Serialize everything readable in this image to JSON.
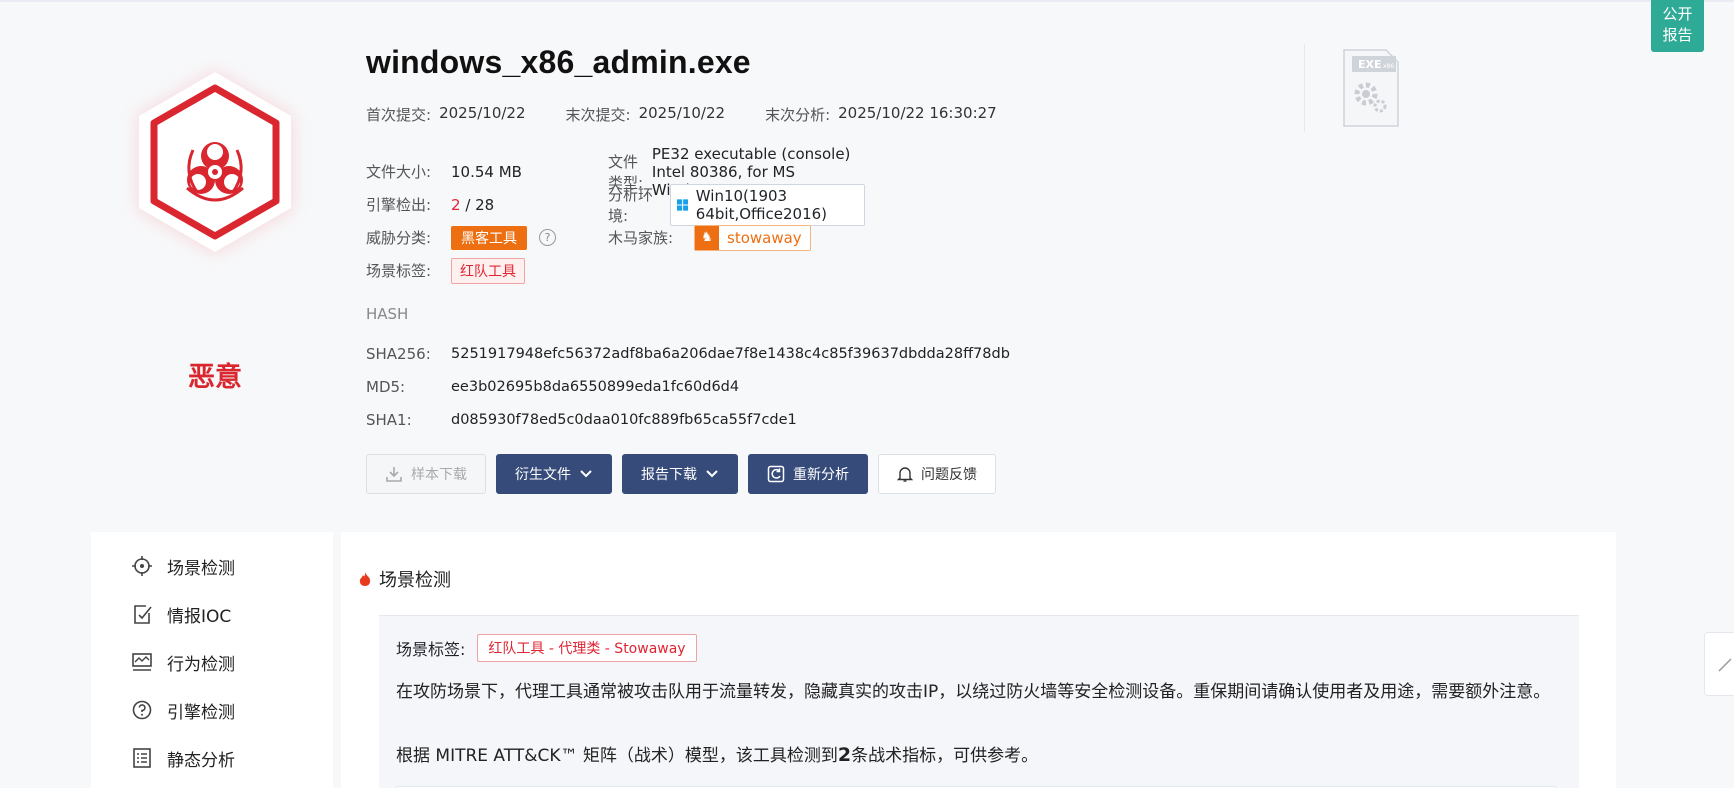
{
  "file": {
    "title": "windows_x86_admin.exe",
    "verdict": "恶意",
    "first_submit_label": "首次提交:",
    "first_submit": "2025/10/22",
    "last_submit_label": "末次提交:",
    "last_submit": "2025/10/22",
    "last_analysis_label": "末次分析:",
    "last_analysis": "2025/10/22 16:30:27",
    "size_label": "文件大小:",
    "size": "10.54 MB",
    "type_label": "文件类型:",
    "type": "PE32 executable (console) Intel 80386, for MS Windows",
    "engine_label": "引擎检出:",
    "engine_hits": "2",
    "engine_total": " / 28",
    "env_label": "分析环境:",
    "env": "Win10(1903 64bit,Office2016)",
    "threat_label": "威胁分类:",
    "threat": "黑客工具",
    "family_label": "木马家族:",
    "family": "stowaway",
    "scene_label": "场景标签:",
    "scene": "红队工具",
    "file_icon_label": "EXE",
    "file_icon_sub": "x86"
  },
  "hash": {
    "title": "HASH",
    "sha256_label": "SHA256:",
    "sha256": "5251917948efc56372adf8ba6a206dae7f8e1438c4c85f39637dbdda28ff78db",
    "md5_label": "MD5:",
    "md5": "ee3b02695b8da6550899eda1fc60d6d4",
    "sha1_label": "SHA1:",
    "sha1": "d085930f78ed5c0daa010fc889fb65ca55f7cde1"
  },
  "buttons": {
    "download_sample": "样本下载",
    "derived_files": "衍生文件",
    "report_download": "报告下载",
    "reanalyze": "重新分析",
    "feedback": "问题反馈"
  },
  "public_report": {
    "line1": "公开",
    "line2": "报告"
  },
  "sidebar": {
    "items": [
      {
        "label": "场景检测",
        "icon": "crosshair-icon"
      },
      {
        "label": "情报IOC",
        "icon": "edit-check-icon"
      },
      {
        "label": "行为检测",
        "icon": "monitor-activity-icon"
      },
      {
        "label": "引擎检测",
        "icon": "question-circle-icon"
      },
      {
        "label": "静态分析",
        "icon": "list-doc-icon"
      }
    ]
  },
  "section": {
    "title": "场景检测",
    "scene_label": "场景标签:",
    "scene_tag": "红队工具 - 代理类 - Stowaway",
    "paragraph": "在攻防场景下，代理工具通常被攻击队用于流量转发，隐藏真实的攻击IP，以绕过防火墙等安全检测设备。重保期间请确认使用者及用途，需要额外注意。",
    "mitre_prefix": "根据 MITRE ATT&CK™ 矩阵（战术）模型，该工具检测到",
    "mitre_count": "2",
    "mitre_suffix": "条战术指标，可供参考。"
  },
  "colors": {
    "malicious": "#d9262f",
    "primary_button": "#364b7a",
    "threat_tag": "#ee6f12",
    "public_report": "#2eaa96"
  }
}
